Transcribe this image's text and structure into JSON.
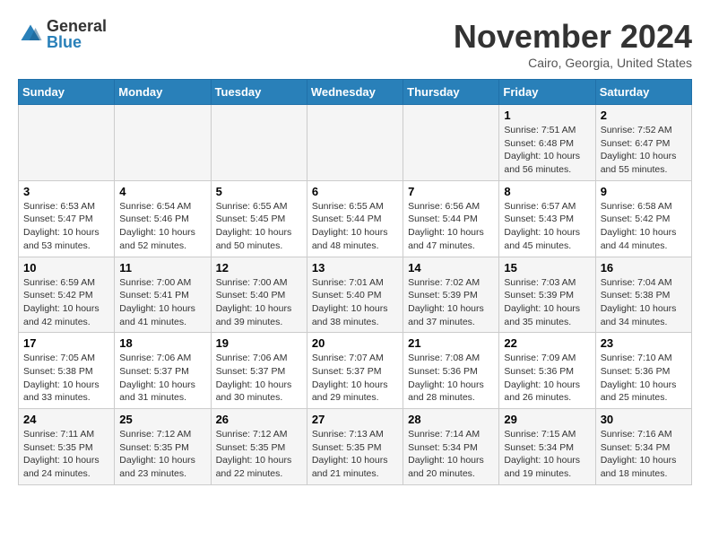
{
  "header": {
    "logo_general": "General",
    "logo_blue": "Blue",
    "month_title": "November 2024",
    "location": "Cairo, Georgia, United States"
  },
  "weekdays": [
    "Sunday",
    "Monday",
    "Tuesday",
    "Wednesday",
    "Thursday",
    "Friday",
    "Saturday"
  ],
  "weeks": [
    [
      {
        "day": "",
        "info": ""
      },
      {
        "day": "",
        "info": ""
      },
      {
        "day": "",
        "info": ""
      },
      {
        "day": "",
        "info": ""
      },
      {
        "day": "",
        "info": ""
      },
      {
        "day": "1",
        "info": "Sunrise: 7:51 AM\nSunset: 6:48 PM\nDaylight: 10 hours and 56 minutes."
      },
      {
        "day": "2",
        "info": "Sunrise: 7:52 AM\nSunset: 6:47 PM\nDaylight: 10 hours and 55 minutes."
      }
    ],
    [
      {
        "day": "3",
        "info": "Sunrise: 6:53 AM\nSunset: 5:47 PM\nDaylight: 10 hours and 53 minutes."
      },
      {
        "day": "4",
        "info": "Sunrise: 6:54 AM\nSunset: 5:46 PM\nDaylight: 10 hours and 52 minutes."
      },
      {
        "day": "5",
        "info": "Sunrise: 6:55 AM\nSunset: 5:45 PM\nDaylight: 10 hours and 50 minutes."
      },
      {
        "day": "6",
        "info": "Sunrise: 6:55 AM\nSunset: 5:44 PM\nDaylight: 10 hours and 48 minutes."
      },
      {
        "day": "7",
        "info": "Sunrise: 6:56 AM\nSunset: 5:44 PM\nDaylight: 10 hours and 47 minutes."
      },
      {
        "day": "8",
        "info": "Sunrise: 6:57 AM\nSunset: 5:43 PM\nDaylight: 10 hours and 45 minutes."
      },
      {
        "day": "9",
        "info": "Sunrise: 6:58 AM\nSunset: 5:42 PM\nDaylight: 10 hours and 44 minutes."
      }
    ],
    [
      {
        "day": "10",
        "info": "Sunrise: 6:59 AM\nSunset: 5:42 PM\nDaylight: 10 hours and 42 minutes."
      },
      {
        "day": "11",
        "info": "Sunrise: 7:00 AM\nSunset: 5:41 PM\nDaylight: 10 hours and 41 minutes."
      },
      {
        "day": "12",
        "info": "Sunrise: 7:00 AM\nSunset: 5:40 PM\nDaylight: 10 hours and 39 minutes."
      },
      {
        "day": "13",
        "info": "Sunrise: 7:01 AM\nSunset: 5:40 PM\nDaylight: 10 hours and 38 minutes."
      },
      {
        "day": "14",
        "info": "Sunrise: 7:02 AM\nSunset: 5:39 PM\nDaylight: 10 hours and 37 minutes."
      },
      {
        "day": "15",
        "info": "Sunrise: 7:03 AM\nSunset: 5:39 PM\nDaylight: 10 hours and 35 minutes."
      },
      {
        "day": "16",
        "info": "Sunrise: 7:04 AM\nSunset: 5:38 PM\nDaylight: 10 hours and 34 minutes."
      }
    ],
    [
      {
        "day": "17",
        "info": "Sunrise: 7:05 AM\nSunset: 5:38 PM\nDaylight: 10 hours and 33 minutes."
      },
      {
        "day": "18",
        "info": "Sunrise: 7:06 AM\nSunset: 5:37 PM\nDaylight: 10 hours and 31 minutes."
      },
      {
        "day": "19",
        "info": "Sunrise: 7:06 AM\nSunset: 5:37 PM\nDaylight: 10 hours and 30 minutes."
      },
      {
        "day": "20",
        "info": "Sunrise: 7:07 AM\nSunset: 5:37 PM\nDaylight: 10 hours and 29 minutes."
      },
      {
        "day": "21",
        "info": "Sunrise: 7:08 AM\nSunset: 5:36 PM\nDaylight: 10 hours and 28 minutes."
      },
      {
        "day": "22",
        "info": "Sunrise: 7:09 AM\nSunset: 5:36 PM\nDaylight: 10 hours and 26 minutes."
      },
      {
        "day": "23",
        "info": "Sunrise: 7:10 AM\nSunset: 5:36 PM\nDaylight: 10 hours and 25 minutes."
      }
    ],
    [
      {
        "day": "24",
        "info": "Sunrise: 7:11 AM\nSunset: 5:35 PM\nDaylight: 10 hours and 24 minutes."
      },
      {
        "day": "25",
        "info": "Sunrise: 7:12 AM\nSunset: 5:35 PM\nDaylight: 10 hours and 23 minutes."
      },
      {
        "day": "26",
        "info": "Sunrise: 7:12 AM\nSunset: 5:35 PM\nDaylight: 10 hours and 22 minutes."
      },
      {
        "day": "27",
        "info": "Sunrise: 7:13 AM\nSunset: 5:35 PM\nDaylight: 10 hours and 21 minutes."
      },
      {
        "day": "28",
        "info": "Sunrise: 7:14 AM\nSunset: 5:34 PM\nDaylight: 10 hours and 20 minutes."
      },
      {
        "day": "29",
        "info": "Sunrise: 7:15 AM\nSunset: 5:34 PM\nDaylight: 10 hours and 19 minutes."
      },
      {
        "day": "30",
        "info": "Sunrise: 7:16 AM\nSunset: 5:34 PM\nDaylight: 10 hours and 18 minutes."
      }
    ]
  ]
}
